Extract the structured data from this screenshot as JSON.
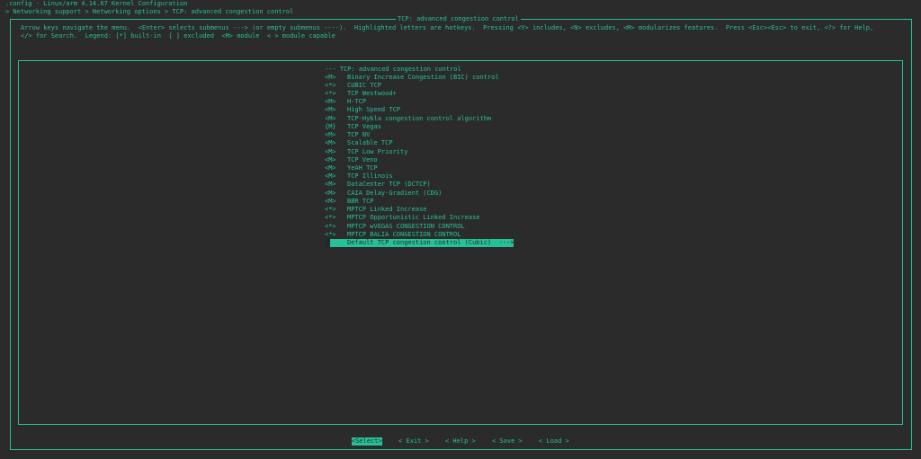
{
  "window_title": ".config - Linux/arm 4.14.67 Kernel Configuration",
  "breadcrumb": "> Networking support > Networking options > TCP: advanced congestion control",
  "dialog_title": "TCP: advanced congestion control",
  "help_line1": "Arrow keys navigate the menu.  <Enter> selects submenus ---> (or empty submenus ----).  Highlighted letters are hotkeys.  Pressing <Y> includes, <N> excludes, <M> modularizes features.  Press <Esc><Esc> to exit, <?> for Help,",
  "help_line2": "</> for Search.  Legend: [*] built-in  [ ] excluded  <M> module  < > module capable",
  "menu_header": "--- TCP: advanced congestion control",
  "menu_items": [
    {
      "mark": "<M>",
      "label": "Binary Increase Congestion (BIC) control"
    },
    {
      "mark": "<*>",
      "label": "CUBIC TCP"
    },
    {
      "mark": "<*>",
      "label": "TCP Westwood+"
    },
    {
      "mark": "<M>",
      "label": "H-TCP"
    },
    {
      "mark": "<M>",
      "label": "High Speed TCP"
    },
    {
      "mark": "<M>",
      "label": "TCP-Hybla congestion control algorithm"
    },
    {
      "mark": "{M}",
      "label": "TCP Vegas"
    },
    {
      "mark": "<M>",
      "label": "TCP NV"
    },
    {
      "mark": "<M>",
      "label": "Scalable TCP"
    },
    {
      "mark": "<M>",
      "label": "TCP Low Priority"
    },
    {
      "mark": "<M>",
      "label": "TCP Veno"
    },
    {
      "mark": "<M>",
      "label": "YeAH TCP"
    },
    {
      "mark": "<M>",
      "label": "TCP Illinois"
    },
    {
      "mark": "<M>",
      "label": "DataCenter TCP (DCTCP)"
    },
    {
      "mark": "<M>",
      "label": "CAIA Delay-Gradient (CDG)"
    },
    {
      "mark": "<M>",
      "label": "BBR TCP"
    },
    {
      "mark": "<*>",
      "label": "MPTCP Linked Increase"
    },
    {
      "mark": "<*>",
      "label": "MPTCP Opportunistic Linked Increase"
    },
    {
      "mark": "<*>",
      "label": "MPTCP wVEGAS CONGESTION CONTROL"
    },
    {
      "mark": "<*>",
      "label": "MPTCP BALIA CONGESTION CONTROL"
    }
  ],
  "selected_item": {
    "label": "Default TCP congestion control (Cubic)  --->"
  },
  "buttons": {
    "select": "<Select>",
    "exit": "< Exit >",
    "help": "< Help >",
    "save": "< Save >",
    "load": "< Load >"
  },
  "colors": {
    "background": "#2b2b2b",
    "foreground": "#26c09a",
    "highlight_text": "#1f2b27"
  }
}
